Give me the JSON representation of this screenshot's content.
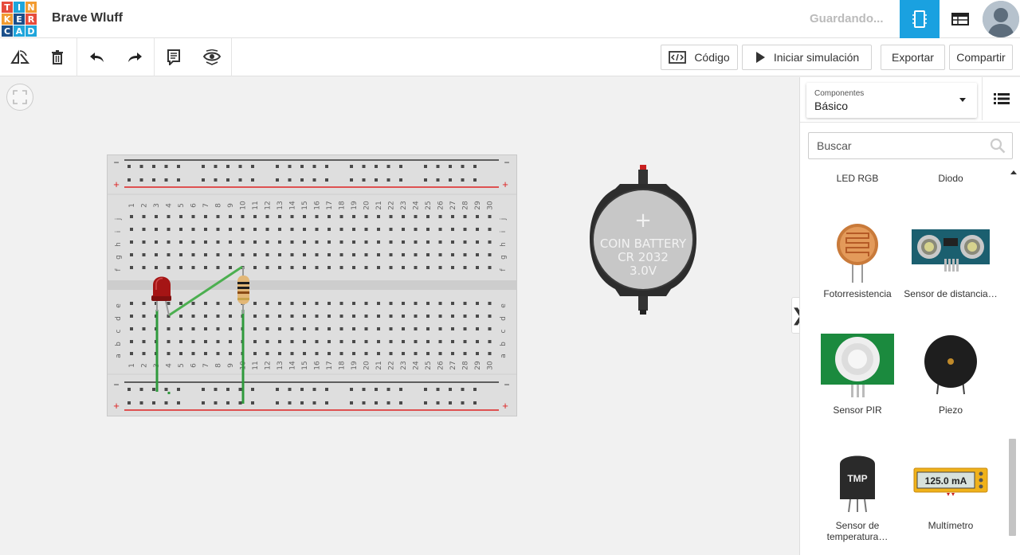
{
  "logo": {
    "letters": [
      "T",
      "I",
      "N",
      "K",
      "E",
      "R",
      "C",
      "A",
      "D"
    ]
  },
  "header": {
    "project_title": "Brave Wluff",
    "status": "Guardando..."
  },
  "toolbar": {
    "code_label": "Código",
    "simulate_label": "Iniciar simulación",
    "export_label": "Exportar",
    "share_label": "Compartir"
  },
  "breadboard": {
    "column_numbers": [
      "1",
      "2",
      "3",
      "4",
      "5",
      "6",
      "7",
      "8",
      "9",
      "10",
      "11",
      "12",
      "13",
      "14",
      "15",
      "16",
      "17",
      "18",
      "19",
      "20",
      "21",
      "22",
      "23",
      "24",
      "25",
      "26",
      "27",
      "28",
      "29",
      "30"
    ],
    "top_rows": [
      "j",
      "i",
      "h",
      "g",
      "f"
    ],
    "bottom_rows": [
      "e",
      "d",
      "c",
      "b",
      "a"
    ],
    "rail_minus": "−",
    "rail_plus": "+"
  },
  "battery": {
    "line1": "COIN BATTERY",
    "line2": "CR 2032",
    "line3": "3.0V",
    "plus": "+"
  },
  "panel": {
    "select_label": "Componentes",
    "select_value": "Básico",
    "search_placeholder": "Buscar",
    "components": [
      {
        "name": "LED RGB",
        "icon": "rgb-led-icon"
      },
      {
        "name": "Diodo",
        "icon": "diode-icon"
      },
      {
        "name": "Fotorresistencia",
        "icon": "photoresistor-icon"
      },
      {
        "name": "Sensor de distancia…",
        "icon": "ultrasonic-sensor-icon"
      },
      {
        "name": "Sensor PIR",
        "icon": "pir-sensor-icon"
      },
      {
        "name": "Piezo",
        "icon": "piezo-icon"
      },
      {
        "name": "Sensor de temperatura…",
        "icon": "temperature-sensor-icon"
      },
      {
        "name": "Multímetro",
        "icon": "multimeter-icon"
      }
    ],
    "tmp_label": "TMP",
    "multimeter_reading": "125.0 mA"
  },
  "colors": {
    "accent": "#1aa1e0",
    "wire": "#4caf50",
    "led": "#a01818",
    "rail_red": "#d22",
    "rail_black": "#333"
  }
}
